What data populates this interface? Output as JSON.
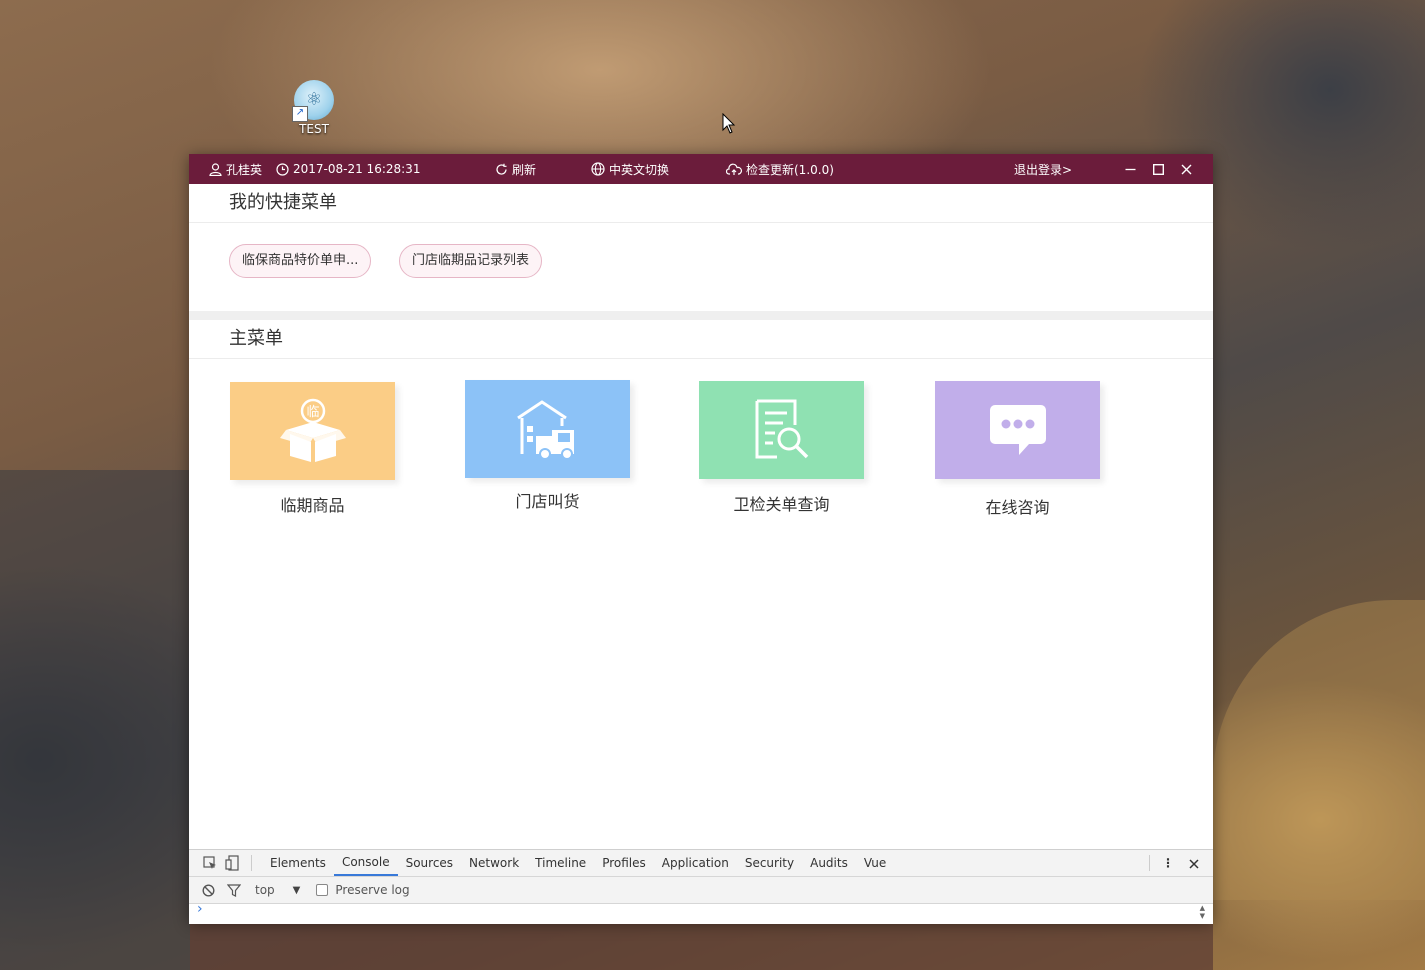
{
  "desktop": {
    "icon_label": "TEST"
  },
  "titlebar": {
    "user": "孔桂英",
    "datetime": "2017-08-21 16:28:31",
    "refresh": "刷新",
    "lang_switch": "中英文切换",
    "update": "检查更新(1.0.0)",
    "logout": "退出登录>"
  },
  "quick_menu": {
    "title": "我的快捷菜单",
    "items": [
      "临保商品特价单申...",
      "门店临期品记录列表"
    ]
  },
  "main_menu": {
    "title": "主菜单",
    "tiles": [
      {
        "label": "临期商品",
        "color": "#fbcd86",
        "icon": "box-icon",
        "badge": "临"
      },
      {
        "label": "门店叫货",
        "color": "#8cc2f7",
        "icon": "warehouse-truck-icon"
      },
      {
        "label": "卫检关单查询",
        "color": "#8fe1b2",
        "icon": "document-search-icon"
      },
      {
        "label": "在线咨询",
        "color": "#c1aeea",
        "icon": "chat-bubble-icon"
      }
    ]
  },
  "devtools": {
    "tabs": [
      "Elements",
      "Console",
      "Sources",
      "Network",
      "Timeline",
      "Profiles",
      "Application",
      "Security",
      "Audits",
      "Vue"
    ],
    "active_tab": "Console",
    "context": "top",
    "preserve_log": "Preserve log",
    "prompt": "›"
  },
  "colors": {
    "titlebar": "#6b1c3b",
    "pill_border": "#e6b6c6",
    "devtools_active": "#3879d9"
  }
}
